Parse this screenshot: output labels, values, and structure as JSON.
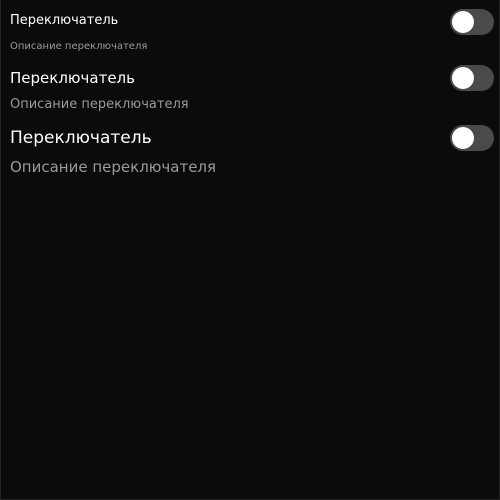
{
  "switches": [
    {
      "title": "Переключатель",
      "description": "Описание переключателя",
      "on": false
    },
    {
      "title": "Переключатель",
      "description": "Описание переключателя",
      "on": false
    },
    {
      "title": "Переключатель",
      "description": "Описание переключателя",
      "on": false
    }
  ],
  "colors": {
    "background": "#0b0b0b",
    "title": "#ffffff",
    "description": "#9a9a9a",
    "track_off": "#4a4a4a",
    "knob": "#ffffff"
  }
}
